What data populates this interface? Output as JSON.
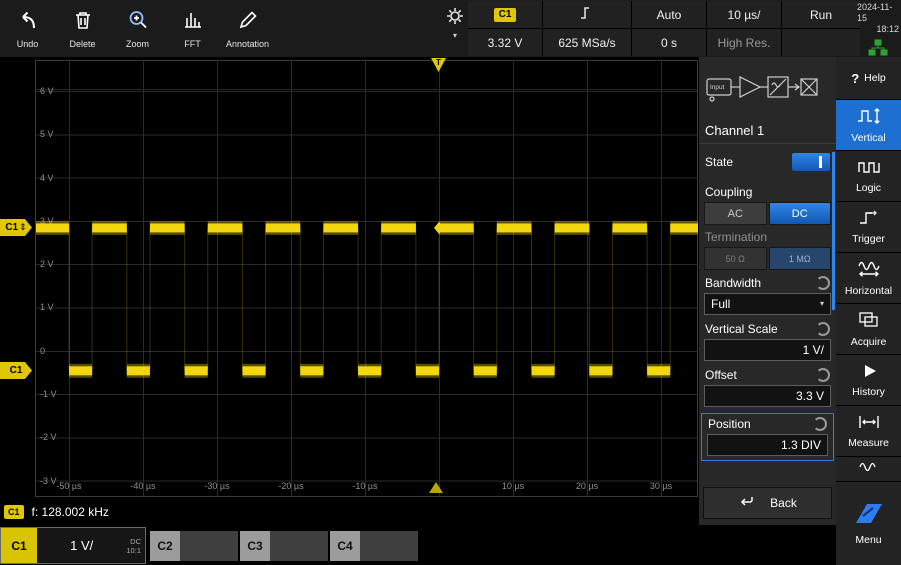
{
  "colors": {
    "accent_blue": "#1d6fd2",
    "channel_yellow": "#e0c700",
    "trace_yellow": "#f2d70e",
    "status_green": "#2fa32f"
  },
  "icons": {
    "chevron_down": "▾",
    "help": "?",
    "updown_arrows": "⇕"
  },
  "toolbar": {
    "buttons": [
      {
        "label": "Undo"
      },
      {
        "label": "Delete"
      },
      {
        "label": "Zoom"
      },
      {
        "label": "FFT"
      },
      {
        "label": "Annotation"
      }
    ],
    "status": {
      "channel_badge": "C1",
      "trigger_level": "3.32 V",
      "trigger_mode": "Auto",
      "sample_rate": "625 MSa/s",
      "timebase": "10 µs/",
      "horizontal_position": "0 s",
      "acquisition_state": "Run",
      "acquisition_mode": "High Res.",
      "date": "2024-11-15",
      "time": "18:12"
    }
  },
  "graph": {
    "y_labels": [
      "6 V",
      "5 V",
      "4 V",
      "3 V",
      "2 V",
      "1 V",
      "0",
      "-1 V",
      "-2 V",
      "-3 V"
    ],
    "x_labels": [
      "-50 µs",
      "-40 µs",
      "-30 µs",
      "-20 µs",
      "-10 µs",
      "10 µs",
      "20 µs",
      "30 µs"
    ],
    "trigger_label": "T",
    "offset_marker": "C1",
    "ground_marker": "C1"
  },
  "chart_data": {
    "type": "line",
    "title": "Channel 1 square wave",
    "waveform": "square",
    "high_v": 3.3,
    "low_v": 0,
    "frequency_hz": 128002,
    "duty_cycle": 0.6,
    "timebase_us_per_div": 10,
    "volts_per_div": 1,
    "x_range_us": [
      -54.5,
      35.1
    ],
    "y_range_v": [
      -3.4,
      6.7
    ],
    "x_ticks_us": [
      -50,
      -40,
      -30,
      -20,
      -10,
      0,
      10,
      20,
      30
    ],
    "y_ticks_v": [
      6,
      5,
      4,
      3,
      2,
      1,
      0,
      -1,
      -2,
      -3
    ]
  },
  "measurement": {
    "channel": "C1",
    "text": "f: 128.002 kHz"
  },
  "channel_tabs": [
    {
      "name": "C1",
      "scale": "1 V/",
      "coupling": "DC",
      "probe": "10:1"
    },
    {
      "name": "C2"
    },
    {
      "name": "C3"
    },
    {
      "name": "C4"
    }
  ],
  "dialog": {
    "input_label": "Input",
    "title": "Channel 1",
    "state_label": "State",
    "coupling_label": "Coupling",
    "coupling_ac": "AC",
    "coupling_dc": "DC",
    "termination_label": "Termination",
    "termination_50": "50 Ω",
    "termination_1m": "1 MΩ",
    "bandwidth_label": "Bandwidth",
    "bandwidth_value": "Full",
    "vertical_scale_label": "Vertical Scale",
    "vertical_scale_value": "1 V/",
    "offset_label": "Offset",
    "offset_value": "3.3 V",
    "position_label": "Position",
    "position_value": "1.3 DIV",
    "back_label": "Back"
  },
  "sidebar": {
    "help": {
      "label": "Help"
    },
    "items": [
      {
        "label": "Vertical",
        "active": true
      },
      {
        "label": "Logic"
      },
      {
        "label": "Trigger"
      },
      {
        "label": "Horizontal"
      },
      {
        "label": "Acquire"
      },
      {
        "label": "History"
      },
      {
        "label": "Measure"
      }
    ],
    "menu_label": "Menu"
  }
}
